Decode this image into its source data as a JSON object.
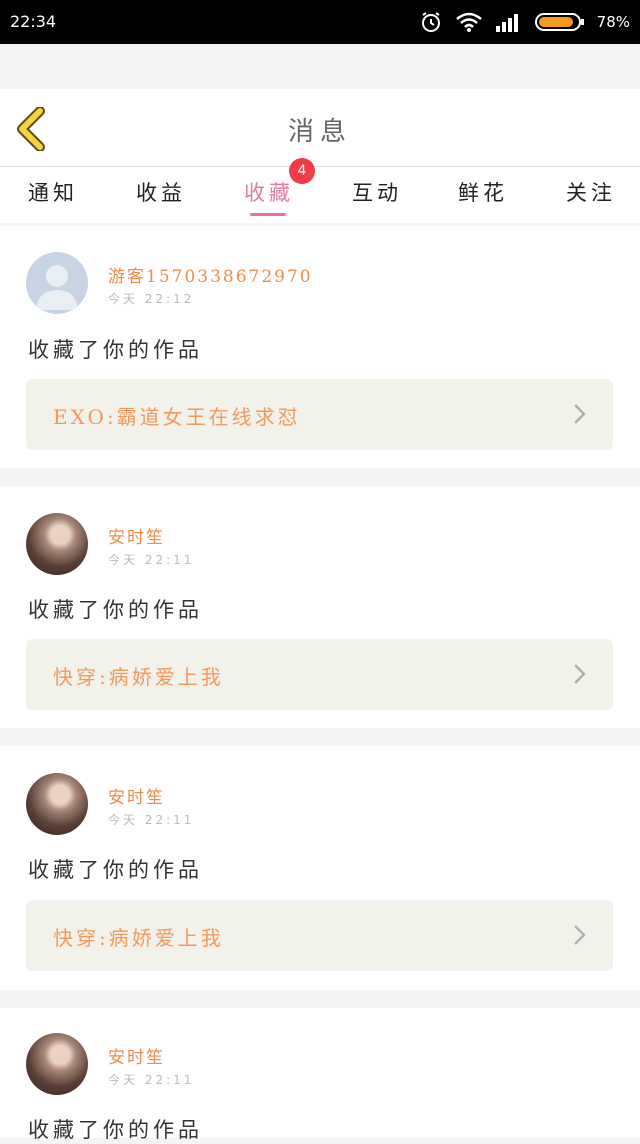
{
  "status": {
    "time": "22:34",
    "battery": "78%"
  },
  "header": {
    "title": "消息"
  },
  "tabs": [
    {
      "label": "通知"
    },
    {
      "label": "收益"
    },
    {
      "label": "收藏",
      "badge": "4"
    },
    {
      "label": "互动"
    },
    {
      "label": "鲜花"
    },
    {
      "label": "关注"
    }
  ],
  "active_tab": "收藏",
  "messages": [
    {
      "user": "游客1570338672970",
      "time": "今天 22:12",
      "action": "收藏了你的作品",
      "work": "EXO:霸道女王在线求怼",
      "avatar": "default-avatar-icon"
    },
    {
      "user": "安时笙",
      "time": "今天 22:11",
      "action": "收藏了你的作品",
      "work": "快穿:病娇爱上我",
      "avatar": "photo"
    },
    {
      "user": "安时笙",
      "time": "今天 22:11",
      "action": "收藏了你的作品",
      "work": "快穿:病娇爱上我",
      "avatar": "photo"
    },
    {
      "user": "安时笙",
      "time": "今天 22:11",
      "action": "收藏了你的作品",
      "work": "",
      "avatar": "photo"
    }
  ],
  "colors": {
    "accent": "#e57ca0",
    "name": "#f08b4a",
    "badge": "#ef3b4a",
    "work_bg": "#f3f2ea",
    "back": "#f5d33f"
  }
}
